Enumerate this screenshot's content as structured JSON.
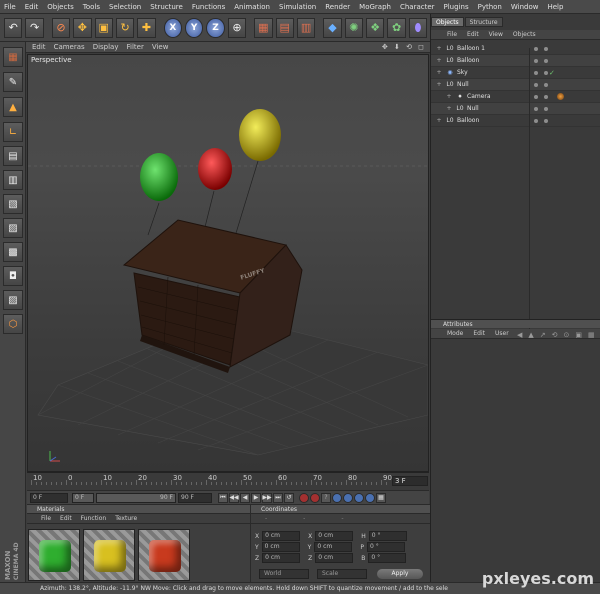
{
  "menu": [
    "File",
    "Edit",
    "Objects",
    "Tools",
    "Selection",
    "Structure",
    "Functions",
    "Animation",
    "Simulation",
    "Render",
    "MoGraph",
    "Character",
    "Plugins",
    "Python",
    "Window",
    "Help"
  ],
  "toolbar": {
    "undo_icon": "↶",
    "redo_icon": "↷",
    "select_icon": "⊘",
    "move_icon": "✥",
    "scale_icon": "▣",
    "rotate_icon": "↻",
    "add_icon": "✚",
    "x_label": "X",
    "y_label": "Y",
    "z_label": "Z",
    "world_icon": "⊕",
    "render_view_icon": "▦",
    "render_picture_icon": "▤",
    "render_settings_icon": "▥",
    "cube_icon": "◆",
    "spline_icon": "✺",
    "nurbs_icon": "❖",
    "array_icon": "✿",
    "deformer_icon": "⬮"
  },
  "left_tools": [
    "▦",
    "✎",
    "▲",
    "∟",
    "▤",
    "▥",
    "▧",
    "▨",
    "▩",
    "◘",
    "▨",
    "⬡"
  ],
  "viewport": {
    "menu": [
      "Edit",
      "Cameras",
      "Display",
      "Filter",
      "View"
    ],
    "nav_icons": "✥ ⬇ ⟲ ◻",
    "label": "Perspective",
    "house_sign": "FLUFFY"
  },
  "timeline": {
    "ticks": [
      "10",
      "0",
      "10",
      "20",
      "30",
      "40",
      "50",
      "60",
      "70",
      "80",
      "90"
    ],
    "current_frame": "3 F"
  },
  "playbar": {
    "start": "0 F",
    "min": "0 F",
    "max": "90 F",
    "end": "90 F",
    "buttons": [
      "⏮",
      "◀◀",
      "◀",
      "▶",
      "▶▶",
      "⏭",
      "↺"
    ]
  },
  "materials": {
    "title": "Materials",
    "menu": [
      "File",
      "Edit",
      "Function",
      "Texture"
    ],
    "swatches": [
      {
        "name": "green",
        "color": "#2fae2f"
      },
      {
        "name": "yellow",
        "color": "#d8c020"
      },
      {
        "name": "red",
        "color": "#c83a1e"
      }
    ]
  },
  "coordinates": {
    "title": "Coordinates",
    "rows": [
      {
        "a": "X",
        "av": "0 cm",
        "b": "X",
        "bv": "0 cm",
        "c": "H",
        "cv": "0 °"
      },
      {
        "a": "Y",
        "av": "0 cm",
        "b": "Y",
        "bv": "0 cm",
        "c": "P",
        "cv": "0 °"
      },
      {
        "a": "Z",
        "av": "0 cm",
        "b": "Z",
        "bv": "0 cm",
        "c": "B",
        "cv": "0 °"
      }
    ],
    "mode1": "World",
    "mode2": "Scale",
    "apply": "Apply"
  },
  "status": "Azimuth: 138.2°, Altitude: -11.9°  NW  Move: Click and drag to move elements. Hold down SHIFT to quantize movement / add to the sele",
  "brand": {
    "line1": "MAXON",
    "line2": "CINEMA 4D"
  },
  "objects": {
    "tabs": [
      "Objects",
      "Structure"
    ],
    "menu": [
      "File",
      "Edit",
      "View",
      "Objects"
    ],
    "items": [
      {
        "icon": "L0",
        "label": "Balloon 1",
        "indent": 0,
        "check": "",
        "tag": false
      },
      {
        "icon": "L0",
        "label": "Balloon",
        "indent": 0,
        "check": "",
        "tag": false
      },
      {
        "icon": "◉",
        "label": "Sky",
        "indent": 0,
        "check": "✓",
        "tag": false
      },
      {
        "icon": "L0",
        "label": "Null",
        "indent": 0,
        "check": "",
        "tag": false
      },
      {
        "icon": "⏺",
        "label": "Camera",
        "indent": 1,
        "check": "",
        "tag": true
      },
      {
        "icon": "L0",
        "label": "Null",
        "indent": 1,
        "check": "",
        "tag": false
      },
      {
        "icon": "L0",
        "label": "Balloon",
        "indent": 0,
        "check": "",
        "tag": false
      }
    ]
  },
  "attributes": {
    "title": "Attributes",
    "menu": [
      "Mode",
      "Edit",
      "User"
    ],
    "nav": [
      "◀",
      "▲",
      "↗",
      "⟲",
      "⊙",
      "▣",
      "▦"
    ]
  },
  "watermark": "pxleyes.com"
}
